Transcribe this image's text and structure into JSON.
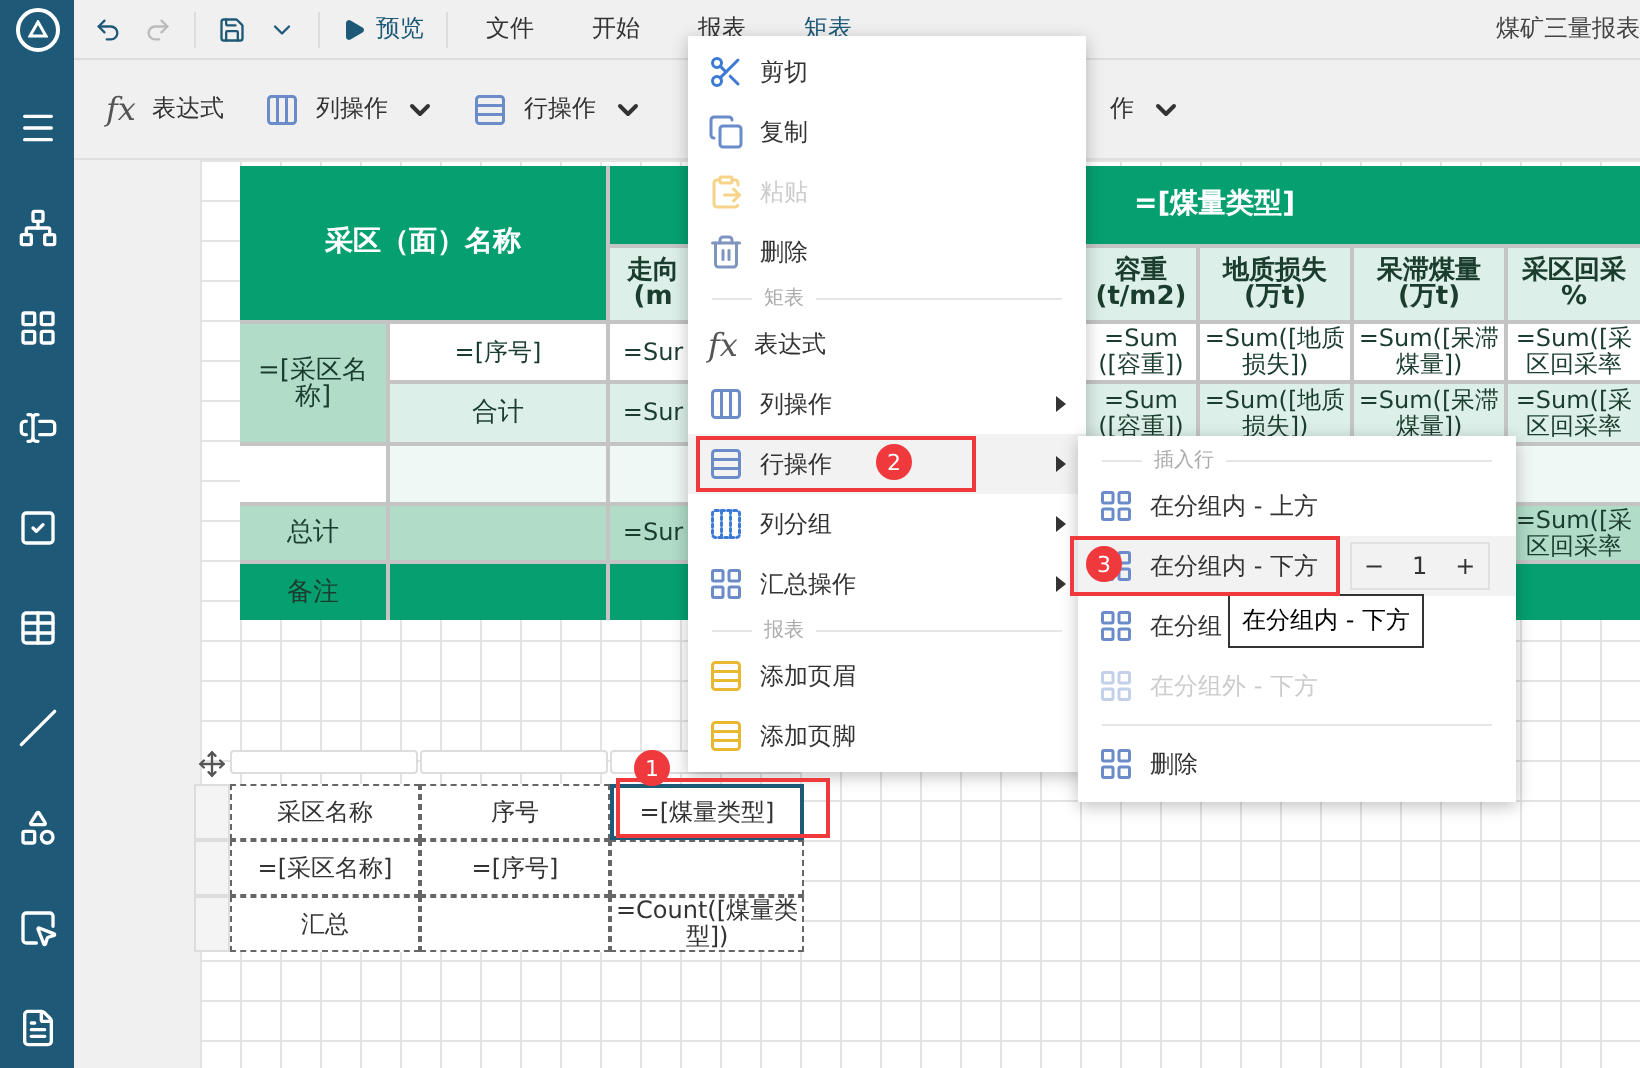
{
  "topbar": {
    "preview": "预览",
    "menus": [
      {
        "label": "文件",
        "selected": false
      },
      {
        "label": "开始",
        "selected": false
      },
      {
        "label": "报表",
        "selected": false
      },
      {
        "label": "矩表",
        "selected": true
      }
    ],
    "title": "煤矿三量报表"
  },
  "toolbar": [
    {
      "glyph": "fx",
      "label": "表达式",
      "dropdown": false
    },
    {
      "label": "列操作",
      "dropdown": true
    },
    {
      "label": "行操作",
      "dropdown": true
    },
    {
      "label": "作",
      "dropdown": true
    }
  ],
  "report": {
    "name_header": "采区（面）名称",
    "group_header": "=[煤量类型]",
    "columns": [
      {
        "header": [
          "走向",
          "(m"
        ]
      },
      {
        "header": [
          "容重",
          "(t/m2)"
        ]
      },
      {
        "header": [
          "地质损失",
          "(万t)"
        ]
      },
      {
        "header": [
          "呆滞煤量",
          "(万t)"
        ]
      },
      {
        "header": [
          "采区回采",
          "%"
        ]
      }
    ],
    "group_cell": "=[采区名称]",
    "index_cell": "=[序号]",
    "subtotal_label": "合计",
    "total_label": "总计",
    "remarks_label": "备注",
    "detail_values": [
      "=Sur",
      "=Sum([容重])",
      "=Sum([地质损失])",
      "=Sum([呆滞煤量])",
      "=Sum([采区回采率"
    ],
    "subtotal_values": [
      "=Sur",
      "=Sum([容重])",
      "=Sum([地质损失])",
      "=Sum([呆滞煤量])",
      "=Sum([采区回采率"
    ],
    "total_values": [
      "=Sur",
      "=Sum([采区回采率"
    ]
  },
  "designer": {
    "rows": [
      [
        {
          "text": "采区名称",
          "selected": false
        },
        {
          "text": "序号",
          "selected": false
        },
        {
          "text": "=[煤量类型]",
          "selected": true
        }
      ],
      [
        {
          "text": "=[采区名称]",
          "selected": false
        },
        {
          "text": "=[序号]",
          "selected": false
        },
        {
          "selected": false
        }
      ],
      [
        {
          "text": "汇总",
          "selected": false
        },
        {
          "selected": false
        },
        {
          "text": "=Count([煤量类型])",
          "selected": false
        }
      ]
    ]
  },
  "context_menu": [
    {
      "kind": "item",
      "label": "剪切",
      "disabled": false,
      "submenu": false,
      "selected": false
    },
    {
      "kind": "item",
      "label": "复制",
      "disabled": false,
      "submenu": false,
      "selected": false
    },
    {
      "kind": "item",
      "label": "粘贴",
      "disabled": true,
      "submenu": false,
      "selected": false
    },
    {
      "kind": "item",
      "label": "删除",
      "disabled": false,
      "submenu": false,
      "selected": false
    },
    {
      "kind": "section",
      "label": "矩表"
    },
    {
      "kind": "item",
      "glyph": "fx",
      "label": "表达式",
      "disabled": false,
      "submenu": false,
      "selected": false
    },
    {
      "kind": "item",
      "label": "列操作",
      "disabled": false,
      "submenu": true,
      "selected": false
    },
    {
      "kind": "item",
      "label": "行操作",
      "disabled": false,
      "submenu": true,
      "selected": true
    },
    {
      "kind": "item",
      "label": "列分组",
      "disabled": false,
      "submenu": true,
      "selected": false
    },
    {
      "kind": "item",
      "label": "汇总操作",
      "disabled": false,
      "submenu": true,
      "selected": false
    },
    {
      "kind": "section",
      "label": "报表"
    },
    {
      "kind": "item",
      "label": "添加页眉",
      "disabled": false,
      "submenu": false,
      "selected": false
    },
    {
      "kind": "item",
      "label": "添加页脚",
      "disabled": false,
      "submenu": false,
      "selected": false
    }
  ],
  "submenu": [
    {
      "kind": "section",
      "label": "插入行"
    },
    {
      "kind": "item",
      "label": "在分组内 - 上方",
      "disabled": false,
      "selected": false
    },
    {
      "kind": "item",
      "label": "在分组内 - 下方",
      "disabled": false,
      "selected": true,
      "count": "1",
      "minus": "−",
      "plus": "+"
    },
    {
      "kind": "item",
      "label": "在分组",
      "disabled": false,
      "selected": false
    },
    {
      "kind": "item",
      "label": "在分组外 - 下方",
      "disabled": true,
      "selected": false
    },
    {
      "kind": "divider"
    },
    {
      "kind": "item",
      "label": "删除",
      "disabled": false,
      "selected": false
    }
  ],
  "tooltip": "在分组内 - 下方",
  "callouts": [
    "1",
    "2",
    "3"
  ]
}
